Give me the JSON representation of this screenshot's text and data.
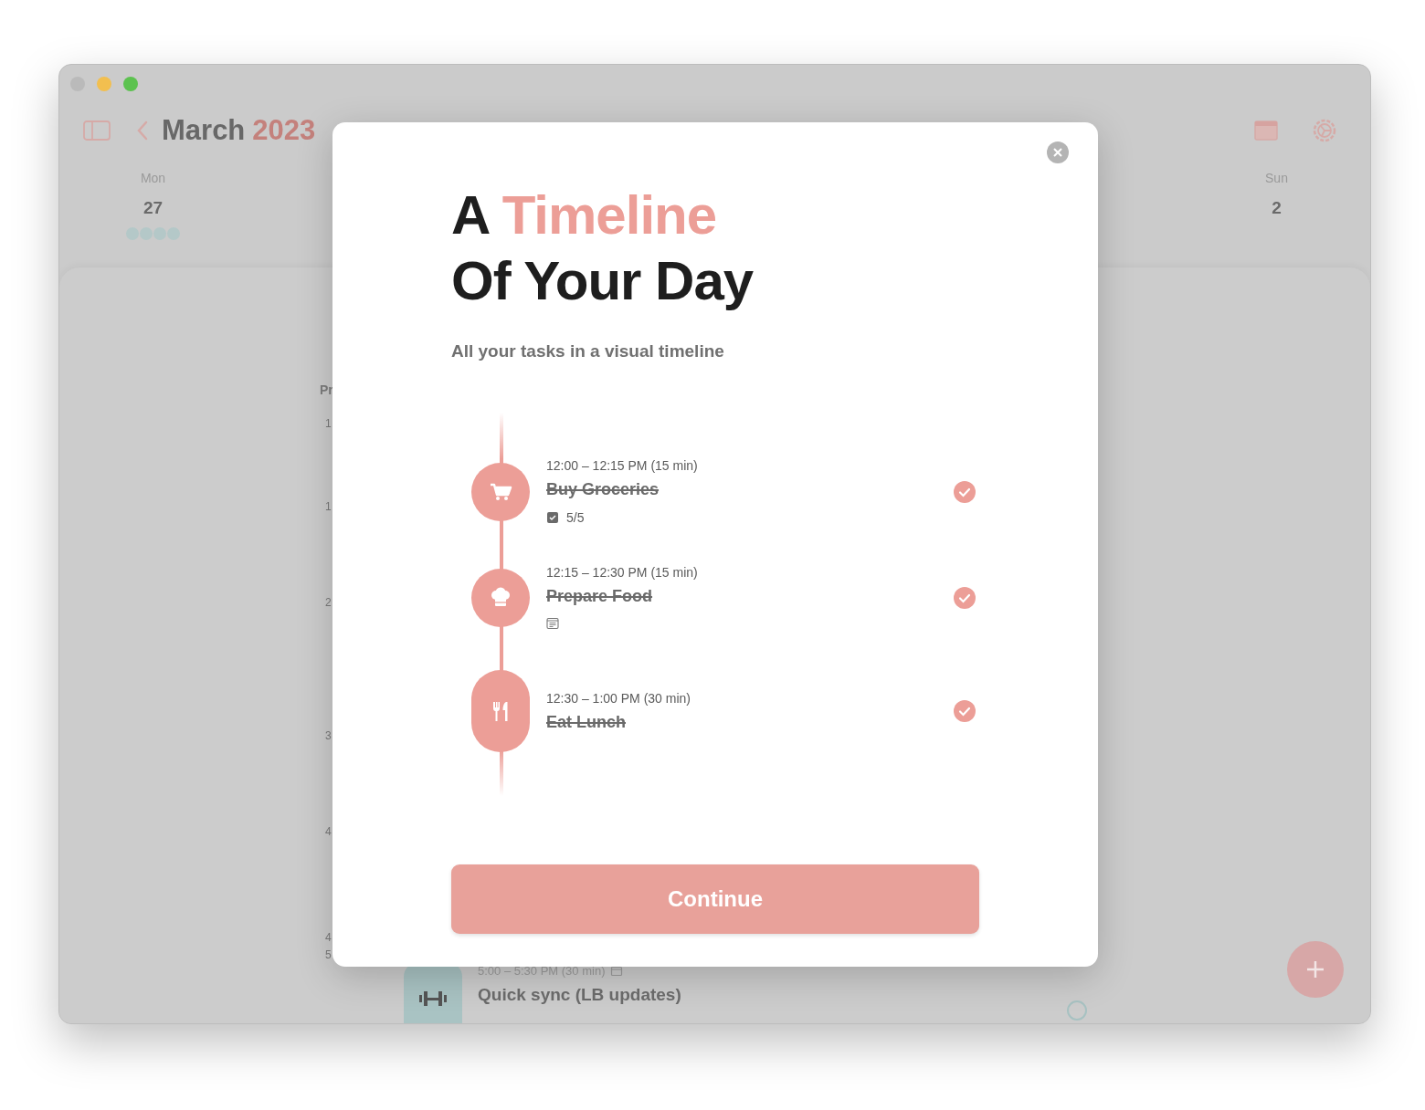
{
  "window": {
    "traffic_lights": [
      {
        "color": "#bababa"
      },
      {
        "color": "#f2bf4f"
      },
      {
        "color": "#5cc24f"
      }
    ]
  },
  "header": {
    "month": "March",
    "year": "2023"
  },
  "days": [
    {
      "weekday": "Mon",
      "date": "27",
      "has_badges": true
    },
    {
      "weekday": "Sun",
      "date": "2",
      "has_badges": false
    }
  ],
  "schedule": {
    "heading": "Pr",
    "hours": [
      "1",
      "1",
      "2",
      "3",
      "4",
      "4",
      "5"
    ],
    "task": {
      "time": "5:00 – 5:30 PM (30 min)",
      "title": "Quick sync (LB updates)",
      "done": false
    }
  },
  "modal": {
    "title": [
      {
        "text": "A",
        "accent": false,
        "new_line": false
      },
      {
        "text": "Timeline",
        "accent": true,
        "new_line": false
      },
      {
        "text": "Of Your Day",
        "accent": false,
        "new_line": true
      }
    ],
    "subtitle": "All your tasks in a visual timeline",
    "items": [
      {
        "time": "12:00 – 12:15 PM (15 min)",
        "title": "Buy Groceries",
        "done": true,
        "subtasks": "5/5",
        "has_notes": false,
        "kind": "short"
      },
      {
        "time": "12:15 – 12:30 PM (15 min)",
        "title": "Prepare Food",
        "done": true,
        "has_notes": true,
        "kind": "short"
      },
      {
        "time": "12:30 – 1:00 PM (30 min)",
        "title": "Eat Lunch",
        "done": true,
        "has_notes": false,
        "kind": "long"
      }
    ],
    "button": "Continue"
  }
}
